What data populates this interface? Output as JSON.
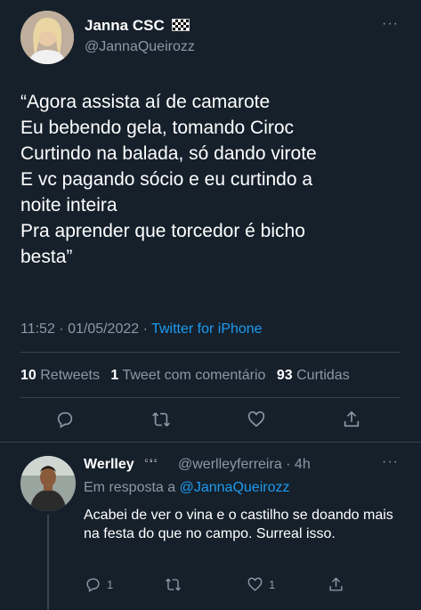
{
  "tweet": {
    "display_name": "Janna CSC",
    "flag_icon": "checkered-flag-icon",
    "handle": "@JannaQueirozz",
    "text_lines": [
      "“Agora assista aí de camarote",
      "Eu bebendo gela, tomando Ciroc",
      "Curtindo na balada, só dando virote",
      "E vc pagando sócio e eu curtindo a",
      "noite inteira",
      "Pra aprender que torcedor é bicho",
      "besta”"
    ],
    "time": "11:52 · 01/05/2022 ·",
    "source": "Twitter for iPhone",
    "stats": {
      "retweets_count": "10",
      "retweets_label": "Retweets",
      "quotes_count": "1",
      "quotes_label": "Tweet com comentário",
      "likes_count": "93",
      "likes_label": "Curtidas"
    },
    "more_label": "···"
  },
  "reply": {
    "display_name": "Werlley",
    "badge": "ᶜˢᶜ",
    "handle_time": "@werlleyferreira · 4h",
    "replying_prefix": "Em resposta a",
    "replying_to": "@JannaQueirozz",
    "text": "Acabei de ver o vina e o castilho se doando mais na festa do que no campo. Surreal isso.",
    "reply_count": "1",
    "like_count": "1",
    "more_label": "···"
  },
  "colors": {
    "background": "#15202b",
    "text": "#ffffff",
    "secondary": "#8b98a5",
    "accent": "#1d9bf0",
    "divider": "#38444d"
  }
}
